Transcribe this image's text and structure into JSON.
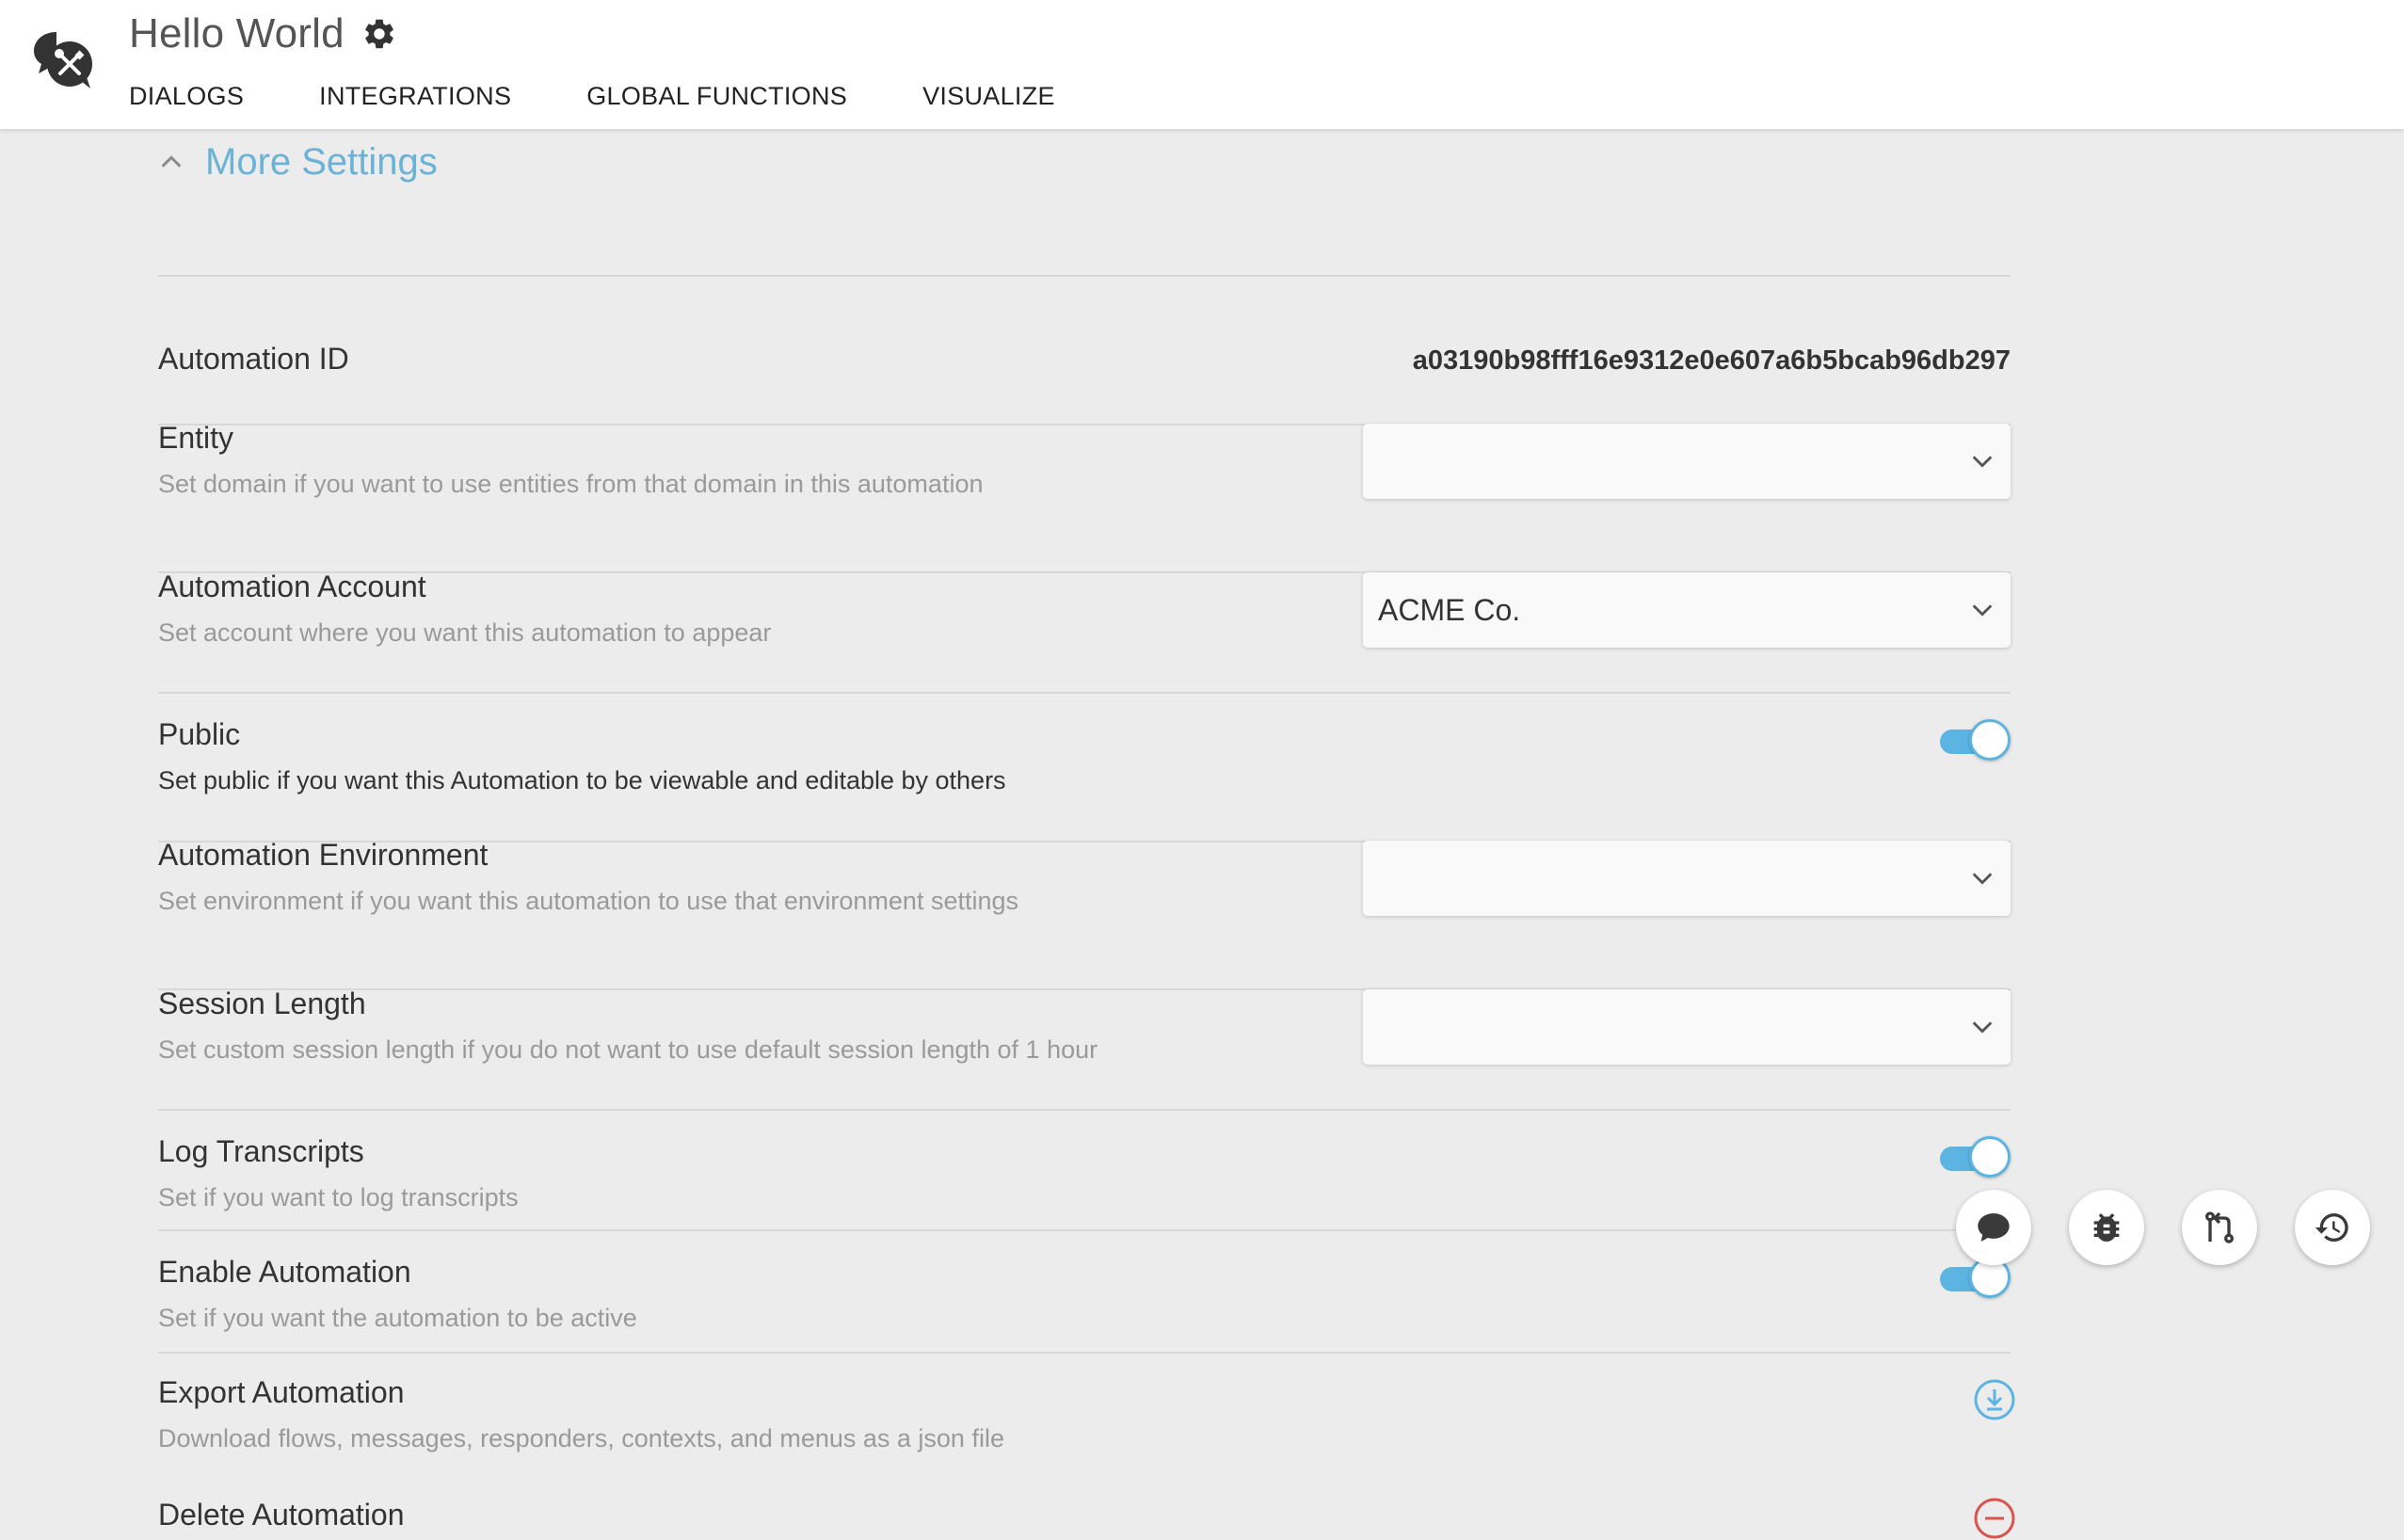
{
  "header": {
    "app_title": "Hello World",
    "logo_icon": "chat-tools-logo-icon",
    "settings_icon": "gear-icon",
    "tabs": [
      {
        "label": "DIALOGS"
      },
      {
        "label": "INTEGRATIONS"
      },
      {
        "label": "GLOBAL FUNCTIONS"
      },
      {
        "label": "VISUALIZE"
      }
    ]
  },
  "settings": {
    "section_title": "More Settings",
    "section_expanded": true,
    "automation_id": {
      "label": "Automation ID",
      "value": "a03190b98fff16e9312e0e607a6b5bcab96db297"
    },
    "entity": {
      "label": "Entity",
      "description": "Set domain if you want to use entities from that domain in this automation",
      "value": ""
    },
    "account": {
      "label": "Automation Account",
      "description": "Set account where you want this automation to appear",
      "value": "ACME Co."
    },
    "public": {
      "label": "Public",
      "description": "Set public if you want this Automation to be viewable and editable by others",
      "enabled": true
    },
    "environment": {
      "label": "Automation Environment",
      "description": "Set environment if you want this automation to use that environment settings",
      "value": ""
    },
    "session_length": {
      "label": "Session Length",
      "description": "Set custom session length if you do not want to use default session length of 1 hour",
      "value": ""
    },
    "log_transcripts": {
      "label": "Log Transcripts",
      "description": "Set if you want to log transcripts",
      "enabled": true
    },
    "enable_automation": {
      "label": "Enable Automation",
      "description": "Set if you want the automation to be active",
      "enabled": true
    },
    "export": {
      "label": "Export Automation",
      "description": "Download flows, messages, responders, contexts, and menus as a json file",
      "icon": "download-icon"
    },
    "delete": {
      "label": "Delete Automation",
      "icon": "delete-icon"
    }
  },
  "fabs": [
    {
      "icon": "chat-bubble-icon"
    },
    {
      "icon": "bug-icon"
    },
    {
      "icon": "git-compare-icon"
    },
    {
      "icon": "history-icon"
    }
  ],
  "colors": {
    "accent": "#5bb4e2",
    "section_title": "#6ab2d6",
    "background": "#ececec",
    "danger": "#d9534f"
  }
}
